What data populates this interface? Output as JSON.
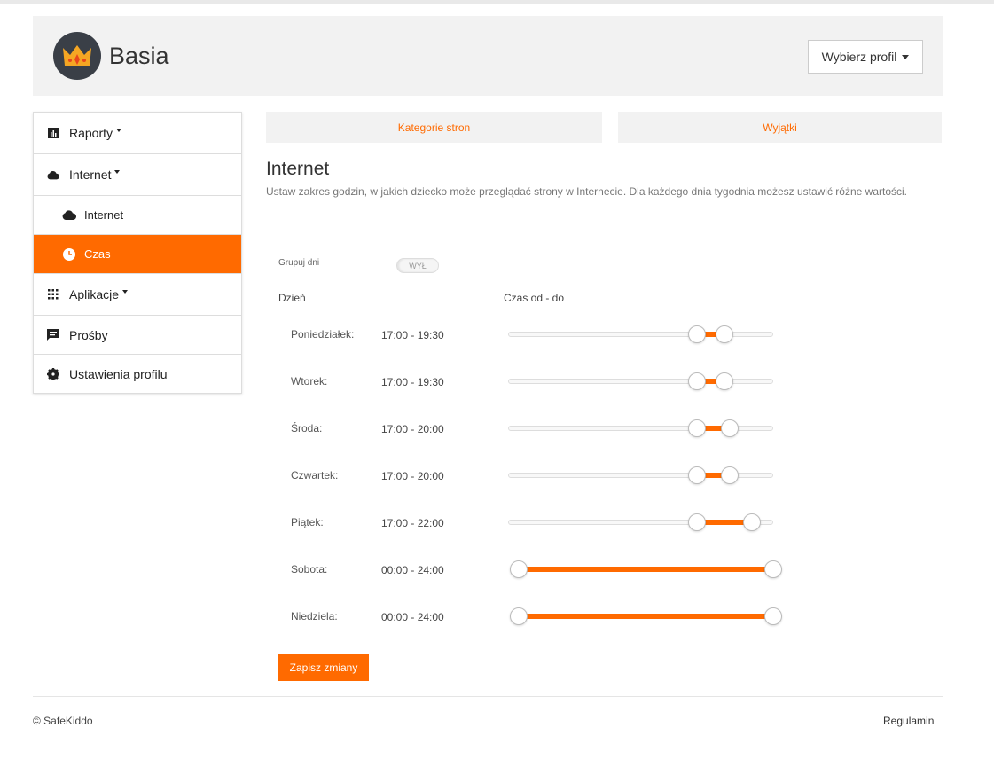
{
  "header": {
    "profile_name": "Basia",
    "profile_select_label": "Wybierz profil"
  },
  "sidebar": {
    "items": [
      {
        "label": "Raporty",
        "icon": "bar-chart-icon"
      },
      {
        "label": "Internet",
        "icon": "cloud-icon"
      },
      {
        "label": "Internet",
        "icon": "cloud-icon"
      },
      {
        "label": "Czas",
        "icon": "clock-icon",
        "active": true
      },
      {
        "label": "Aplikacje",
        "icon": "apps-grid-icon"
      },
      {
        "label": "Prośby",
        "icon": "message-icon"
      },
      {
        "label": "Ustawienia profilu",
        "icon": "gear-icon"
      }
    ]
  },
  "tabs": [
    {
      "label": "Kategorie stron"
    },
    {
      "label": "Wyjątki"
    }
  ],
  "main": {
    "title": "Internet",
    "description": "Ustaw zakres godzin, w jakich dziecko może przeglądać strony w Internecie. Dla każdego dnia tygodnia możesz ustawić różne wartości.",
    "group_days_label": "Grupuj dni",
    "group_days_toggle": "WYŁ",
    "col_day": "Dzień",
    "col_time": "Czas od - do",
    "days": [
      {
        "name": "Poniedziałek:",
        "range": "17:00 - 19:30",
        "from_hour": 17,
        "to_hour": 19.5
      },
      {
        "name": "Wtorek:",
        "range": "17:00 - 19:30",
        "from_hour": 17,
        "to_hour": 19.5
      },
      {
        "name": "Środa:",
        "range": "17:00 - 20:00",
        "from_hour": 17,
        "to_hour": 20
      },
      {
        "name": "Czwartek:",
        "range": "17:00 - 20:00",
        "from_hour": 17,
        "to_hour": 20
      },
      {
        "name": "Piątek:",
        "range": "17:00 - 22:00",
        "from_hour": 17,
        "to_hour": 22
      },
      {
        "name": "Sobota:",
        "range": "00:00 - 24:00",
        "from_hour": 0,
        "to_hour": 24
      },
      {
        "name": "Niedziela:",
        "range": "00:00 - 24:00",
        "from_hour": 0,
        "to_hour": 24
      }
    ],
    "save_label": "Zapisz zmiany"
  },
  "footer": {
    "copyright": "© SafeKiddo",
    "terms": "Regulamin"
  },
  "colors": {
    "accent": "#ff6a00",
    "header_bg": "#f2f2f2",
    "avatar_bg": "#3a3f47"
  }
}
